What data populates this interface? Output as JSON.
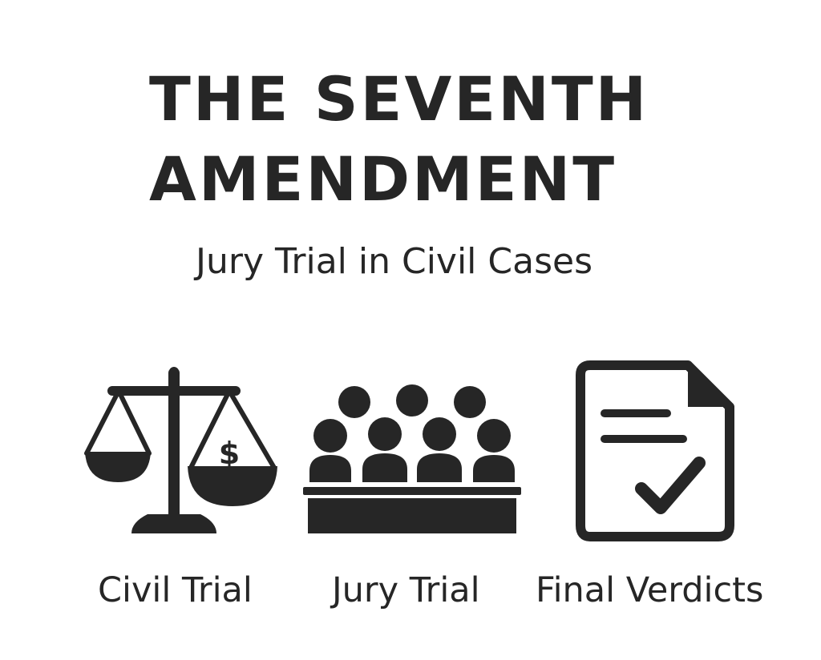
{
  "title": {
    "line1": "THE SEVENTH",
    "line2": "AMENDMENT"
  },
  "subtitle": "Jury Trial in Civil Cases",
  "panels": [
    {
      "icon": "scales-of-justice-icon",
      "label": "Civil Trial",
      "icon_text": "$"
    },
    {
      "icon": "jury-box-icon",
      "label": "Jury Trial"
    },
    {
      "icon": "document-checkmark-icon",
      "label": "Final Verdicts"
    }
  ],
  "colors": {
    "ink": "#262626",
    "background": "#ffffff"
  }
}
